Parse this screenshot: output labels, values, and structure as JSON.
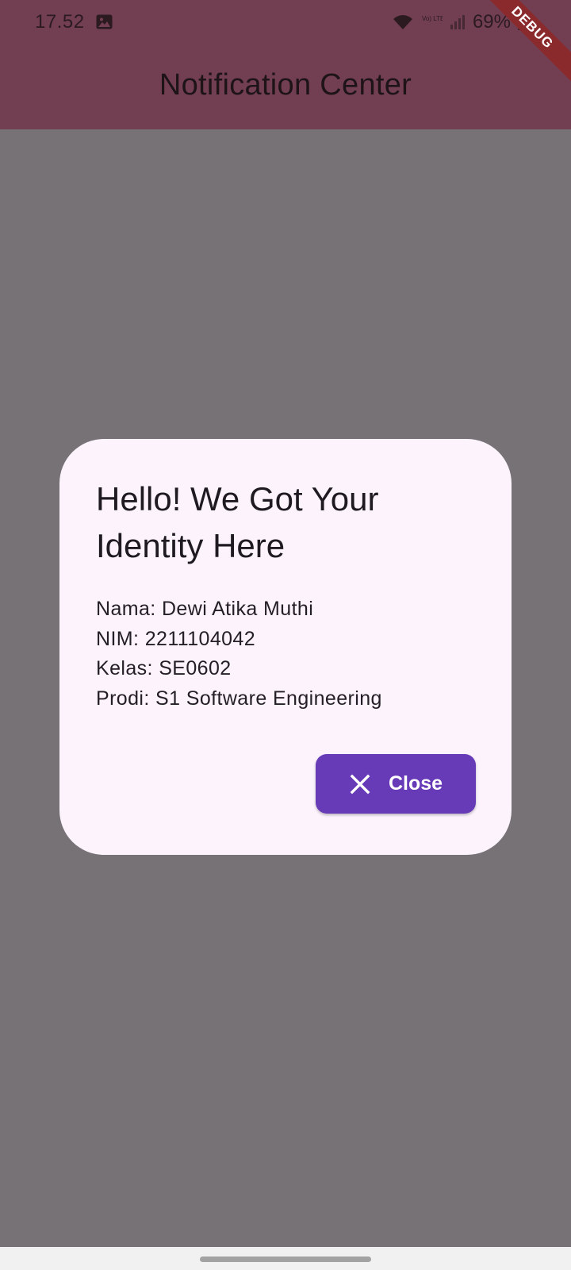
{
  "status_bar": {
    "time": "17.52",
    "battery": "69%",
    "network_label": "Vo) LTE1",
    "icons": [
      "image-icon",
      "wifi-icon",
      "volte-icon",
      "signal-icon",
      "battery-icon"
    ]
  },
  "app_bar": {
    "title": "Notification Center",
    "background": "#723f52"
  },
  "debug_banner": {
    "label": "DEBUG",
    "color": "#8b2a2d"
  },
  "dialog": {
    "title": "Hello! We Got Your Identity Here",
    "lines": [
      "Nama: Dewi Atika Muthi",
      "NIM: 2211104042",
      "Kelas: SE0602",
      "Prodi: S1 Software Engineering"
    ],
    "close_button": {
      "label": "Close",
      "icon": "close-icon",
      "color": "#673ab7"
    }
  }
}
